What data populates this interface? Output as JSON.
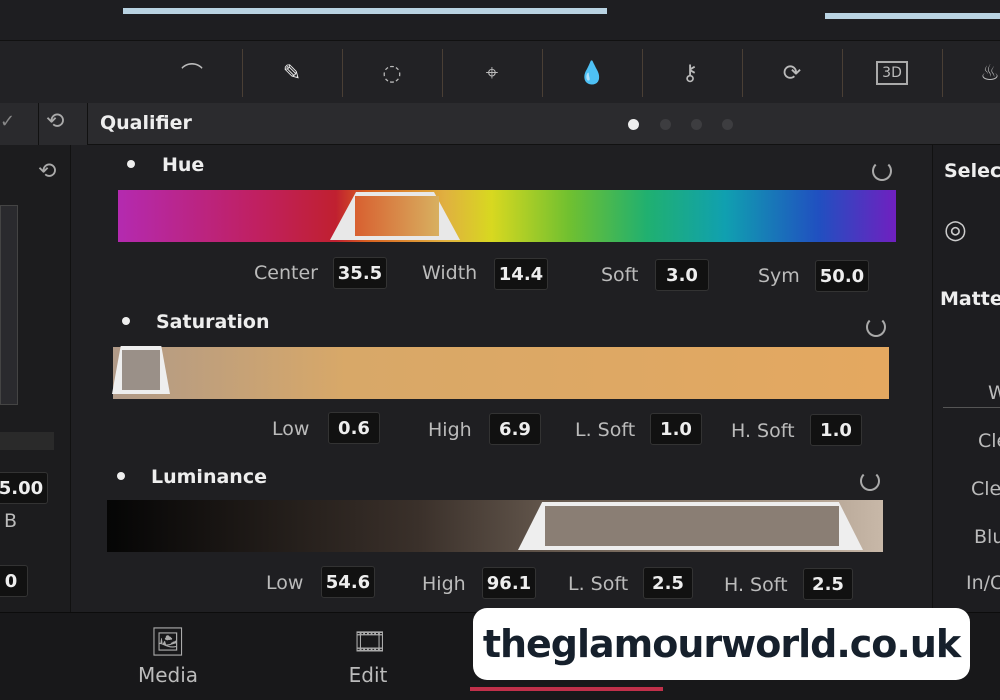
{
  "toolbar": {
    "icons": [
      "curves-icon",
      "eyedropper-icon",
      "power-window-icon",
      "tracker-icon",
      "blur-icon",
      "key-icon",
      "resize-icon",
      "3d-icon",
      "fx-icon"
    ]
  },
  "qualifier": {
    "title": "Qualifier",
    "page_dots": 4,
    "active_dot": 1
  },
  "hue": {
    "label": "Hue",
    "fields": [
      {
        "label": "Center",
        "value": "35.5"
      },
      {
        "label": "Width",
        "value": "14.4"
      },
      {
        "label": "Soft",
        "value": "3.0"
      },
      {
        "label": "Sym",
        "value": "50.0"
      }
    ]
  },
  "saturation": {
    "label": "Saturation",
    "fields": [
      {
        "label": "Low",
        "value": "0.6"
      },
      {
        "label": "High",
        "value": "6.9"
      },
      {
        "label": "L. Soft",
        "value": "1.0"
      },
      {
        "label": "H. Soft",
        "value": "1.0"
      }
    ]
  },
  "luminance": {
    "label": "Luminance",
    "fields": [
      {
        "label": "Low",
        "value": "54.6"
      },
      {
        "label": "High",
        "value": "96.1"
      },
      {
        "label": "L. Soft",
        "value": "2.5"
      },
      {
        "label": "H. Soft",
        "value": "2.5"
      }
    ]
  },
  "left_panel": {
    "value1": "5.00",
    "label_b": "B",
    "value2": "0"
  },
  "right_panel": {
    "select": "Select",
    "matte": "Matte",
    "rows": [
      "W",
      "Cle",
      "Cle",
      "Blu",
      "In/C"
    ]
  },
  "bottom_nav": {
    "items": [
      "Media",
      "Edit"
    ]
  },
  "watermark": "theglamourworld.co.uk",
  "colors": {
    "accent_active": "#c0304a",
    "progress": "#b9d3e2"
  }
}
